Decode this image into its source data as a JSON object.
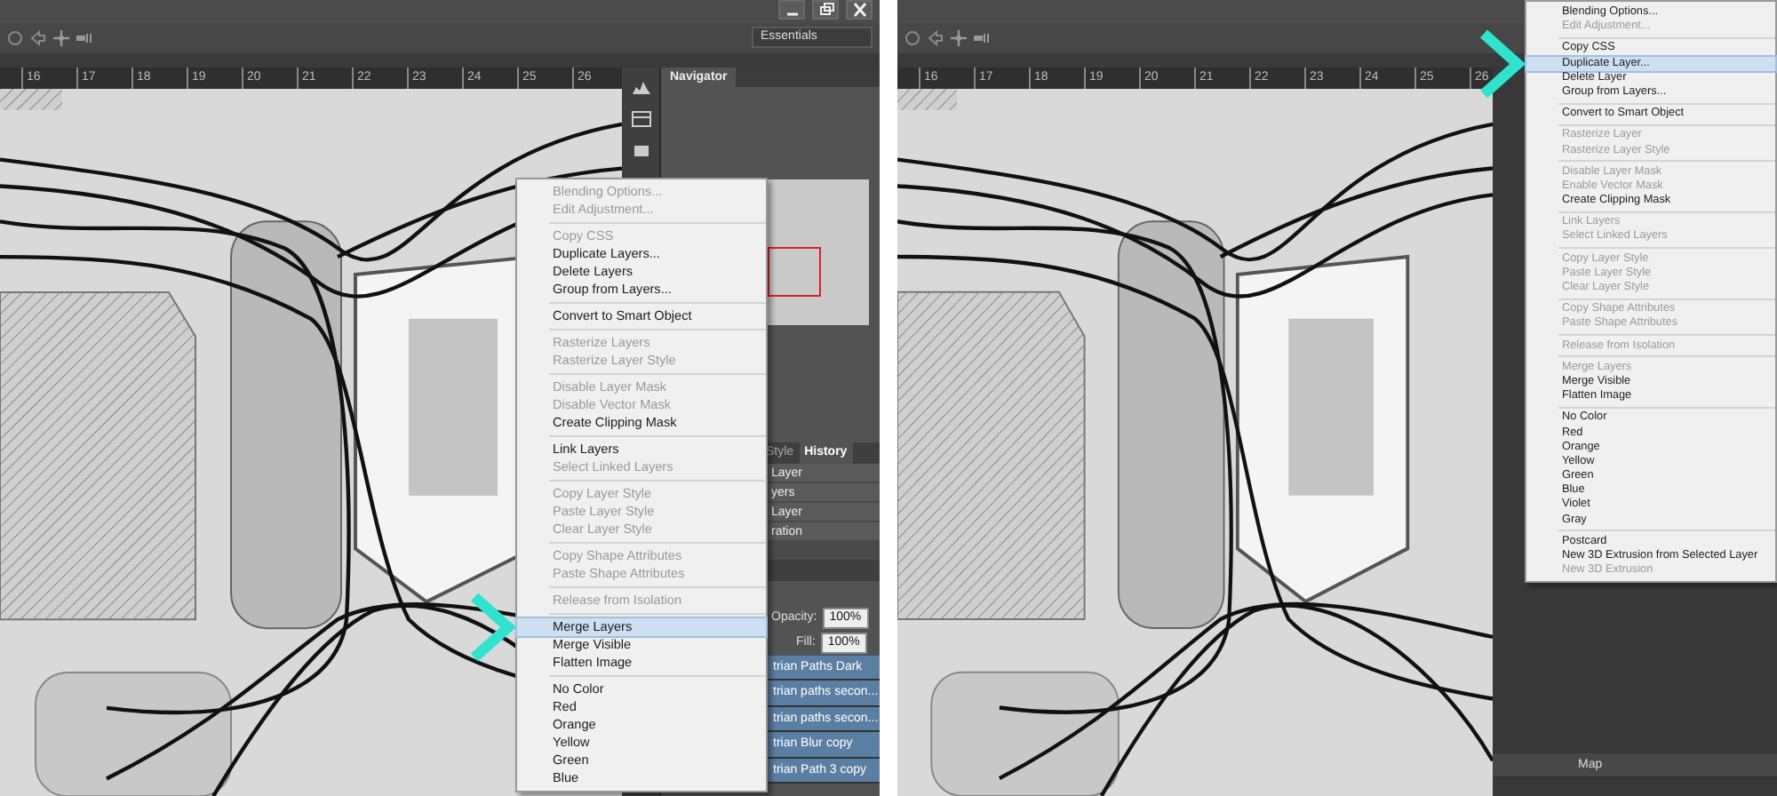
{
  "screens": [
    {
      "window_buttons": true,
      "workspace": "Essentials",
      "ruler": [
        "16",
        "17",
        "18",
        "19",
        "20",
        "21",
        "22",
        "23",
        "24",
        "25",
        "26"
      ],
      "navigator": {
        "title": "Navigator"
      },
      "panel_tabs": [
        {
          "label": "Style",
          "selected": false
        },
        {
          "label": "History",
          "selected": true
        }
      ],
      "history": [
        "Layer",
        "yers",
        "Layer",
        "ration"
      ],
      "layers_panel": {
        "opacity_label": "Opacity:",
        "opacity": "100%",
        "fill_label": "Fill:",
        "fill": "100%",
        "rows": [
          {
            "name": "trian Paths Dark",
            "selected": true
          },
          {
            "name": "trian paths secon...",
            "selected": true
          },
          {
            "name": "trian paths secon...",
            "selected": true
          },
          {
            "name": "trian Blur copy",
            "selected": true
          },
          {
            "name": "trian Path 3 copy",
            "selected": true
          }
        ]
      },
      "context_menu": {
        "groups": [
          [
            {
              "label": "Blending Options...",
              "enabled": false,
              "selected": false
            },
            {
              "label": "Edit Adjustment...",
              "enabled": false,
              "selected": false
            }
          ],
          [
            {
              "label": "Copy CSS",
              "enabled": false,
              "selected": false
            },
            {
              "label": "Duplicate Layers...",
              "enabled": true,
              "selected": false
            },
            {
              "label": "Delete Layers",
              "enabled": true,
              "selected": false
            },
            {
              "label": "Group from Layers...",
              "enabled": true,
              "selected": false
            }
          ],
          [
            {
              "label": "Convert to Smart Object",
              "enabled": true,
              "selected": false
            }
          ],
          [
            {
              "label": "Rasterize Layers",
              "enabled": false,
              "selected": false
            },
            {
              "label": "Rasterize Layer Style",
              "enabled": false,
              "selected": false
            }
          ],
          [
            {
              "label": "Disable Layer Mask",
              "enabled": false,
              "selected": false
            },
            {
              "label": "Disable Vector Mask",
              "enabled": false,
              "selected": false
            },
            {
              "label": "Create Clipping Mask",
              "enabled": true,
              "selected": false
            }
          ],
          [
            {
              "label": "Link Layers",
              "enabled": true,
              "selected": false
            },
            {
              "label": "Select Linked Layers",
              "enabled": false,
              "selected": false
            }
          ],
          [
            {
              "label": "Copy Layer Style",
              "enabled": false,
              "selected": false
            },
            {
              "label": "Paste Layer Style",
              "enabled": false,
              "selected": false
            },
            {
              "label": "Clear Layer Style",
              "enabled": false,
              "selected": false
            }
          ],
          [
            {
              "label": "Copy Shape Attributes",
              "enabled": false,
              "selected": false
            },
            {
              "label": "Paste Shape Attributes",
              "enabled": false,
              "selected": false
            }
          ],
          [
            {
              "label": "Release from Isolation",
              "enabled": false,
              "selected": false
            }
          ],
          [
            {
              "label": "Merge Layers",
              "enabled": true,
              "selected": true
            },
            {
              "label": "Merge Visible",
              "enabled": true,
              "selected": false
            },
            {
              "label": "Flatten Image",
              "enabled": true,
              "selected": false
            }
          ],
          [
            {
              "label": "No Color",
              "enabled": true,
              "selected": false
            },
            {
              "label": "Red",
              "enabled": true,
              "selected": false
            },
            {
              "label": "Orange",
              "enabled": true,
              "selected": false
            },
            {
              "label": "Yellow",
              "enabled": true,
              "selected": false
            },
            {
              "label": "Green",
              "enabled": true,
              "selected": false
            },
            {
              "label": "Blue",
              "enabled": true,
              "selected": false
            }
          ]
        ]
      }
    },
    {
      "ruler": [
        "16",
        "17",
        "18",
        "19",
        "20",
        "21",
        "22",
        "23",
        "24",
        "25",
        "26"
      ],
      "layers_panel": {
        "rows": [
          {
            "name": "Map",
            "selected": false
          }
        ]
      },
      "context_menu": {
        "groups": [
          [
            {
              "label": "Blending Options...",
              "enabled": true,
              "selected": false
            },
            {
              "label": "Edit Adjustment...",
              "enabled": false,
              "selected": false
            }
          ],
          [
            {
              "label": "Copy CSS",
              "enabled": true,
              "selected": false
            },
            {
              "label": "Duplicate Layer...",
              "enabled": true,
              "selected": true
            },
            {
              "label": "Delete Layer",
              "enabled": true,
              "selected": false
            },
            {
              "label": "Group from Layers...",
              "enabled": true,
              "selected": false
            }
          ],
          [
            {
              "label": "Convert to Smart Object",
              "enabled": true,
              "selected": false
            }
          ],
          [
            {
              "label": "Rasterize Layer",
              "enabled": false,
              "selected": false
            },
            {
              "label": "Rasterize Layer Style",
              "enabled": false,
              "selected": false
            }
          ],
          [
            {
              "label": "Disable Layer Mask",
              "enabled": false,
              "selected": false
            },
            {
              "label": "Enable Vector Mask",
              "enabled": false,
              "selected": false
            },
            {
              "label": "Create Clipping Mask",
              "enabled": true,
              "selected": false
            }
          ],
          [
            {
              "label": "Link Layers",
              "enabled": false,
              "selected": false
            },
            {
              "label": "Select Linked Layers",
              "enabled": false,
              "selected": false
            }
          ],
          [
            {
              "label": "Copy Layer Style",
              "enabled": false,
              "selected": false
            },
            {
              "label": "Paste Layer Style",
              "enabled": false,
              "selected": false
            },
            {
              "label": "Clear Layer Style",
              "enabled": false,
              "selected": false
            }
          ],
          [
            {
              "label": "Copy Shape Attributes",
              "enabled": false,
              "selected": false
            },
            {
              "label": "Paste Shape Attributes",
              "enabled": false,
              "selected": false
            }
          ],
          [
            {
              "label": "Release from Isolation",
              "enabled": false,
              "selected": false
            }
          ],
          [
            {
              "label": "Merge Layers",
              "enabled": false,
              "selected": false
            },
            {
              "label": "Merge Visible",
              "enabled": true,
              "selected": false
            },
            {
              "label": "Flatten Image",
              "enabled": true,
              "selected": false
            }
          ],
          [
            {
              "label": "No Color",
              "enabled": true,
              "selected": false
            },
            {
              "label": "Red",
              "enabled": true,
              "selected": false
            },
            {
              "label": "Orange",
              "enabled": true,
              "selected": false
            },
            {
              "label": "Yellow",
              "enabled": true,
              "selected": false
            },
            {
              "label": "Green",
              "enabled": true,
              "selected": false
            },
            {
              "label": "Blue",
              "enabled": true,
              "selected": false
            },
            {
              "label": "Violet",
              "enabled": true,
              "selected": false
            },
            {
              "label": "Gray",
              "enabled": true,
              "selected": false
            }
          ],
          [
            {
              "label": "Postcard",
              "enabled": true,
              "selected": false
            },
            {
              "label": "New 3D Extrusion from Selected Layer",
              "enabled": true,
              "selected": false
            },
            {
              "label": "New 3D Extrusion",
              "enabled": false,
              "selected": false
            }
          ]
        ]
      }
    }
  ]
}
